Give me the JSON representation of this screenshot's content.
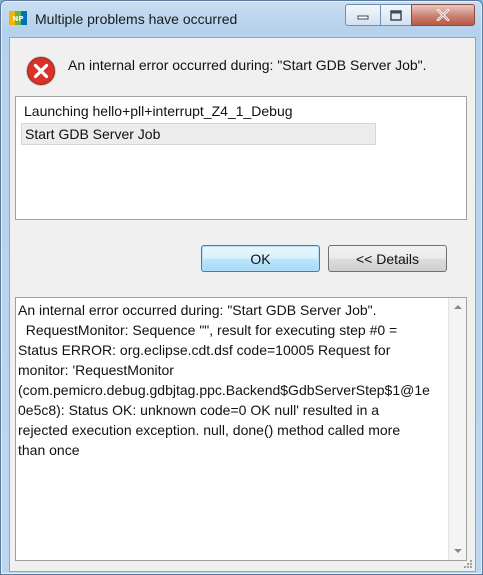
{
  "window": {
    "title": "Multiple problems have occurred",
    "app_icon": "nxp-logo-icon",
    "controls": {
      "minimize": "minimize-icon",
      "maximize": "maximize-icon",
      "close": "close-icon"
    }
  },
  "message": {
    "icon": "error-icon",
    "text": "An internal error occurred during: \"Start GDB Server Job\"."
  },
  "problems": {
    "items": [
      {
        "label": "Launching hello+pll+interrupt_Z4_1_Debug",
        "selected": false
      },
      {
        "label": "Start GDB Server Job",
        "selected": true
      }
    ]
  },
  "buttons": {
    "ok": "OK",
    "details": "<< Details"
  },
  "details": {
    "text": "An internal error occurred during: \"Start GDB Server Job\".\n  RequestMonitor: Sequence \"\", result for executing step #0 =\nStatus ERROR: org.eclipse.cdt.dsf code=10005 Request for\nmonitor: 'RequestMonitor\n(com.pemicro.debug.gdbjtag.ppc.Backend$GdbServerStep$1@1e\n0e5c8): Status OK: unknown code=0 OK null' resulted in a\nrejected execution exception. null, done() method called more\nthan once"
  },
  "colors": {
    "error_red": "#d9322b",
    "ok_border": "#3c7fb1",
    "titlebar": "#b5d1ec"
  }
}
